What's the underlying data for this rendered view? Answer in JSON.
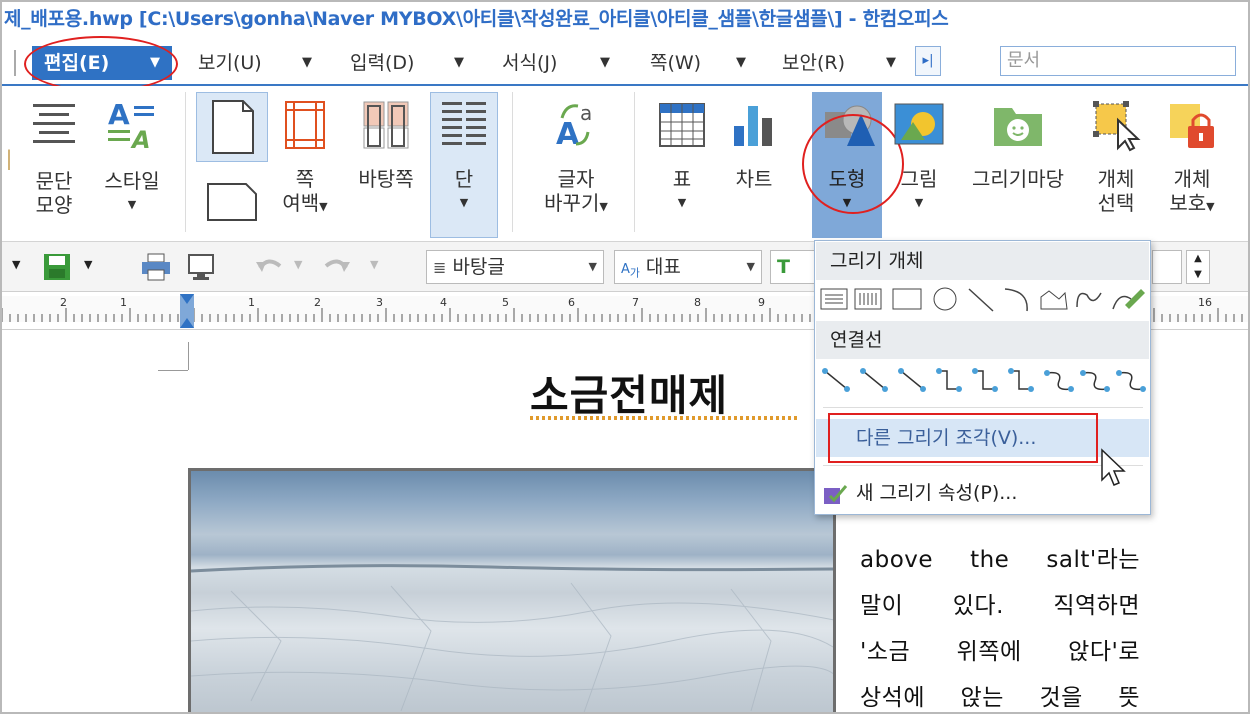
{
  "window": {
    "title": "제_배포용.hwp [C:\\Users\\gonha\\Naver MYBOX\\아티클\\작성완료_아티클\\아티클_샘플\\한글샘플\\] - 한컴오피스"
  },
  "menu": {
    "tabs": [
      {
        "label": "편집(E)"
      },
      {
        "label": "보기(U)"
      },
      {
        "label": "입력(D)"
      },
      {
        "label": "서식(J)"
      },
      {
        "label": "쪽(W)"
      },
      {
        "label": "보안(R)"
      }
    ],
    "search_placeholder": "문서"
  },
  "ribbon": {
    "paragraph_label_1": "문단",
    "paragraph_label_2": "모양",
    "style_label": "스타일",
    "margin_label_1": "쪽",
    "margin_label_2": "여백",
    "background_page": "바탕쪽",
    "column_label": "단",
    "char_replace_1": "글자",
    "char_replace_2": "바꾸기",
    "table_label": "표",
    "chart_label": "차트",
    "shape_label": "도형",
    "picture_label": "그림",
    "drawing_mart": "그리기마당",
    "obj_select_1": "개체",
    "obj_select_2": "선택",
    "obj_protect_1": "개체",
    "obj_protect_2": "보호"
  },
  "toolbar": {
    "style_combo": "바탕글",
    "font_combo": "대표",
    "font_combo_prefix": "가"
  },
  "ruler": {
    "numbers": [
      "2",
      "1",
      "1",
      "2",
      "3",
      "4",
      "5",
      "6",
      "7",
      "8",
      "9",
      "16"
    ]
  },
  "document": {
    "title": "소금전매제",
    "body_lines": [
      "above the salt'라는",
      "말이 있다. 직역하면",
      "'소금 위쪽에 앉다'로",
      "상석에 앉는 것을 뜻"
    ]
  },
  "dropdown": {
    "drawing_objects_header": "그리기 개체",
    "connectors_header": "연결선",
    "other_drawing": "다른 그리기 조각(V)...",
    "new_drawing_props": "새 그리기 속성(P)..."
  },
  "colors": {
    "accent": "#2f72c4",
    "annotation_red": "#e0201f",
    "highlight": "#d7e6f6"
  }
}
